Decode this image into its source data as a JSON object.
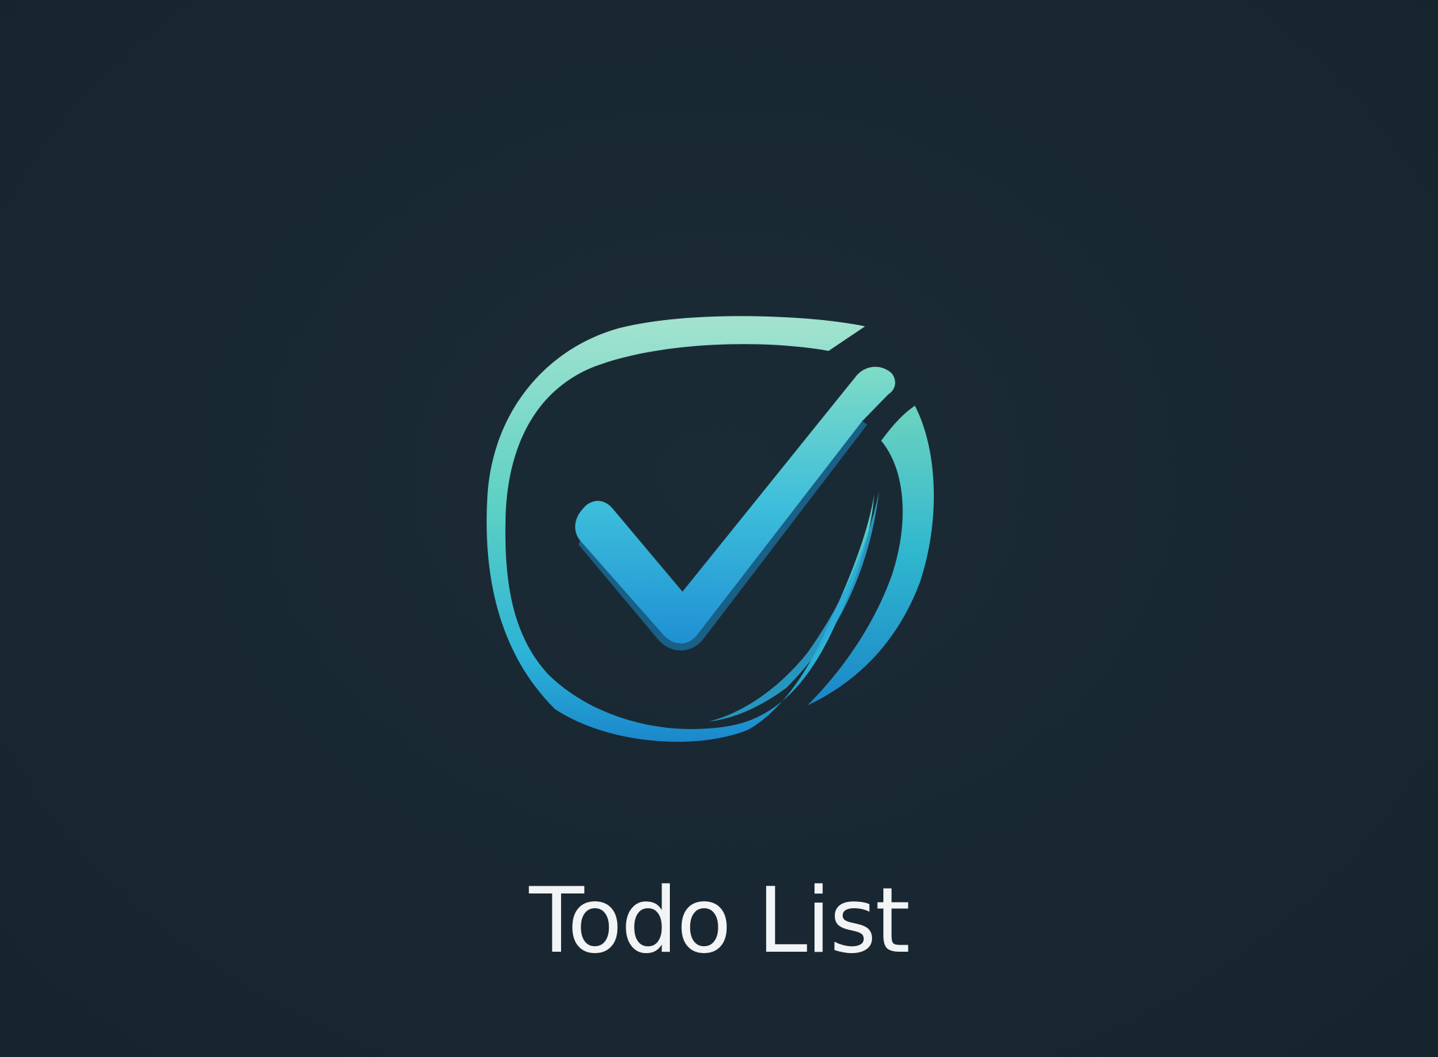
{
  "app": {
    "title": "Todo List",
    "logo_icon": "checkmark-circle-icon"
  },
  "colors": {
    "background": "#192832",
    "logo_gradient_top": "#8fdcc8",
    "logo_gradient_mid": "#3cc3c8",
    "logo_gradient_bottom": "#1e8fd0",
    "title_text": "#f2f4f5"
  }
}
